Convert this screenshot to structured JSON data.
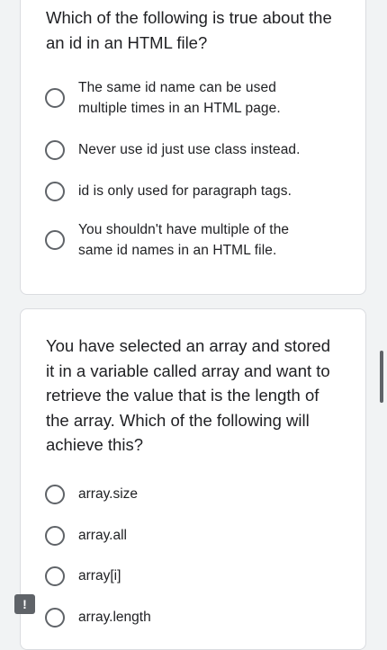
{
  "questions": [
    {
      "text": "Which of the following is true about the an id in an HTML file?",
      "options": [
        {
          "label": "The same id name can be used multiple times in an HTML page."
        },
        {
          "label": "Never use id just use class instead."
        },
        {
          "label": "id is only used for paragraph tags."
        },
        {
          "label": "You shouldn't have multiple of the same id names in an HTML file."
        }
      ]
    },
    {
      "text": "You have selected an array and stored it in a variable called array and want to retrieve the value that is the length of the array. Which of the following will achieve this?",
      "options": [
        {
          "label": "array.size"
        },
        {
          "label": "array.all"
        },
        {
          "label": "array[i]"
        },
        {
          "label": "array.length"
        }
      ]
    }
  ],
  "report_button": {
    "glyph": "!",
    "icon": "feedback-icon"
  },
  "colors": {
    "page_background": "#f1f3f4",
    "card_background": "#ffffff",
    "radio_border": "#5f6368",
    "text": "#202124"
  }
}
